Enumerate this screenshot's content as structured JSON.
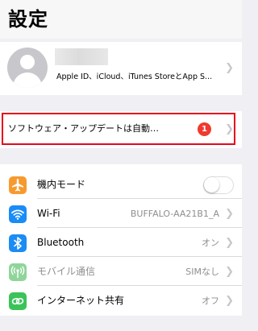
{
  "header": {
    "title": "設定"
  },
  "account": {
    "subtitle": "Apple ID、iCloud、iTunes StoreとApp S..."
  },
  "update": {
    "label": "ソフトウェア・アップデートは自動…",
    "badge": "1",
    "highlight_color": "#e5081b"
  },
  "settings": {
    "airplane": {
      "label": "機内モード",
      "icon": "airplane-icon",
      "color": "#f79a2e",
      "enabled": false
    },
    "wifi": {
      "label": "Wi-Fi",
      "value": "BUFFALO-AA21B1_A",
      "icon": "wifi-icon",
      "color": "#1a8cf5"
    },
    "bluetooth": {
      "label": "Bluetooth",
      "value": "オン",
      "icon": "bluetooth-icon",
      "color": "#1a8cf5"
    },
    "cellular": {
      "label": "モバイル通信",
      "value": "SIMなし",
      "icon": "antenna-icon",
      "color": "#8fd59a"
    },
    "hotspot": {
      "label": "インターネット共有",
      "value": "オフ",
      "icon": "link-icon",
      "color": "#3bc35a"
    }
  }
}
